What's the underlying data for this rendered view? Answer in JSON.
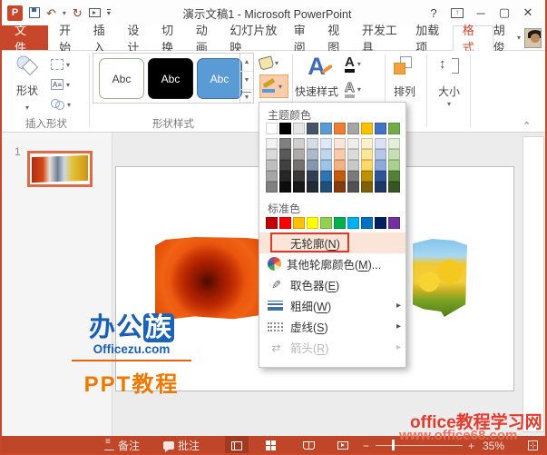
{
  "colors": {
    "accent": "#C8472B",
    "status_bar": "#C0462A",
    "menu_hover_pink": "#FBE5D8",
    "annotation_red": "#DB392C",
    "outline_button_highlight": "#F8CCAD",
    "thumbnail_selection": "#DE6B45"
  },
  "title_bar": {
    "title": "演示文稿1 - Microsoft PowerPoint",
    "logo_letter": "P",
    "quick_access_icons": [
      "save-icon",
      "undo-icon",
      "redo-icon",
      "start-slideshow-icon",
      "customize-qat-icon"
    ],
    "undo_glyph": "↶",
    "redo_glyph": "↻",
    "help_glyph": "?",
    "minimize_glyph": "─",
    "maximize_glyph": "▢",
    "close_glyph": "✕",
    "ribbon_options_glyph": "↑"
  },
  "tab_bar": {
    "file_tab": "文件",
    "tabs": [
      "开始",
      "插入",
      "设计",
      "切换",
      "动画",
      "幻灯片放映",
      "审阅",
      "视图",
      "开发工具",
      "加载项"
    ],
    "active_tab": "格式",
    "user_name": "胡俊",
    "user_caret": "▾"
  },
  "ribbon": {
    "insert_shapes_group": {
      "label": "插入形状",
      "shapes_button": "形状"
    },
    "shape_styles_group": {
      "label": "形状样式",
      "styles": [
        {
          "label": "Abc",
          "bg": "#FFFFFF",
          "border": "#9CAF88",
          "fg": "#3B3B3B"
        },
        {
          "label": "Abc",
          "bg": "#000000",
          "border": "#1A1A1A",
          "fg": "#FFFFFF"
        },
        {
          "label": "Abc",
          "bg": "#5B9BD5",
          "border": "#41719C",
          "fg": "#FFFFFF"
        }
      ],
      "scroll_up_glyph": "▲",
      "scroll_down_glyph": "▼",
      "more_glyph": "▼"
    },
    "quick_styles_button": "快速样式",
    "arrange_button": "排列",
    "size_button": "大小",
    "collapse_glyph": "⌃",
    "caret_glyph": "▾"
  },
  "slides_panel": {
    "slide_number": "1"
  },
  "outline_menu": {
    "theme_colors_label": "主题颜色",
    "standard_colors_label": "标准色",
    "theme_columns": [
      {
        "base": "#FFFFFF",
        "variants": [
          "#F2F2F2",
          "#D9D9D9",
          "#BFBFBF",
          "#A6A6A6",
          "#808080"
        ]
      },
      {
        "base": "#000000",
        "variants": [
          "#808080",
          "#595959",
          "#404040",
          "#262626",
          "#0D0D0D"
        ]
      },
      {
        "base": "#E7E6E6",
        "variants": [
          "#D0CECE",
          "#AEAAAA",
          "#757171",
          "#3B3838",
          "#181717"
        ]
      },
      {
        "base": "#44546A",
        "variants": [
          "#D6DCE5",
          "#ACB9CA",
          "#8497B0",
          "#333F50",
          "#222B35"
        ]
      },
      {
        "base": "#5B9BD5",
        "variants": [
          "#DEEBF7",
          "#BDD7EE",
          "#9DC3E6",
          "#2E74B5",
          "#1F4E79"
        ]
      },
      {
        "base": "#ED7D31",
        "variants": [
          "#FBE5D6",
          "#F8CBAD",
          "#F4B183",
          "#C55A11",
          "#843C0C"
        ]
      },
      {
        "base": "#A5A5A5",
        "variants": [
          "#EDEDED",
          "#DBDBDB",
          "#C9C9C9",
          "#7B7B7B",
          "#525252"
        ]
      },
      {
        "base": "#FFC000",
        "variants": [
          "#FFF2CC",
          "#FFE699",
          "#FFD966",
          "#BF9000",
          "#7F6000"
        ]
      },
      {
        "base": "#4472C4",
        "variants": [
          "#DAE3F3",
          "#B4C7E7",
          "#8EAADB",
          "#2F5597",
          "#1F3864"
        ]
      },
      {
        "base": "#70AD47",
        "variants": [
          "#E2EFDA",
          "#C6E0B4",
          "#A9D18E",
          "#548235",
          "#375623"
        ]
      }
    ],
    "standard_colors": [
      "#C00000",
      "#FF0000",
      "#FFC000",
      "#FFFF00",
      "#92D050",
      "#00B050",
      "#00B0F0",
      "#0070C0",
      "#002060",
      "#7030A0"
    ],
    "items": [
      {
        "label": "无轮廓",
        "key": "N",
        "suffix": "",
        "icon": "none",
        "highlighted": true,
        "annotated": true
      },
      {
        "label": "其他轮廓颜色",
        "key": "M",
        "suffix": "...",
        "icon": "color-wheel-icon"
      },
      {
        "label": "取色器",
        "key": "E",
        "suffix": "",
        "icon": "eyedropper-icon"
      },
      {
        "label": "粗细",
        "key": "W",
        "suffix": "",
        "icon": "line-weight-icon",
        "submenu": true
      },
      {
        "label": "虚线",
        "key": "S",
        "suffix": "",
        "icon": "dash-style-icon",
        "submenu": true
      },
      {
        "label": "箭头",
        "key": "R",
        "suffix": "",
        "icon": "arrows-icon",
        "submenu": true,
        "disabled": true
      }
    ],
    "submenu_glyph": "▸",
    "eyedropper_glyph": "✎",
    "arrows_glyph": "⇄"
  },
  "slide_watermark": {
    "line1_part1": "办公",
    "line1_part2": "族",
    "line2": "Officezu.com",
    "line3": "PPT教程"
  },
  "overlay_watermarks": {
    "site": "office教程学习网",
    "url": "www.office68.com"
  },
  "status_bar": {
    "notes": "备注",
    "comments": "批注",
    "view_icons": [
      "normal-view-icon",
      "slide-sorter-icon",
      "reading-view-icon",
      "slideshow-icon"
    ],
    "zoom_out_glyph": "−",
    "zoom_in_glyph": "+",
    "zoom_level": "35%",
    "fit_glyph": "⊹"
  }
}
